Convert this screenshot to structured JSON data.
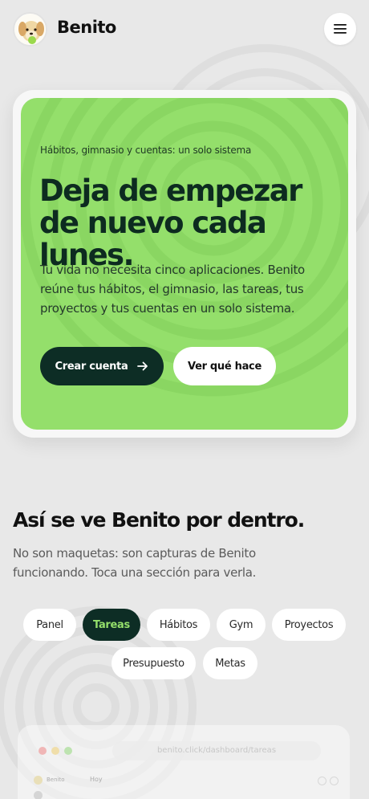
{
  "header": {
    "brand": "Benito",
    "menu_icon": "hamburger-menu-icon"
  },
  "hero": {
    "eyebrow": "Hábitos, gimnasio y cuentas: un solo sistema",
    "title": "Deja de empezar de nuevo cada lunes.",
    "subtitle": "Tu vida no necesita cinco aplicaciones. Benito reúne tus hábitos, el gimnasio, las tareas, tus proyectos y tus cuentas en un solo sistema.",
    "primary_label": "Crear cuenta",
    "primary_icon": "arrow-right-icon",
    "secondary_label": "Ver qué hace",
    "accent_color": "#94df6b",
    "dark_color": "#0d2d25"
  },
  "section": {
    "title": "Así se ve Benito por dentro.",
    "subtitle": "No son maquetas: son capturas de Benito funcionando. Toca una sección para verla."
  },
  "tabs": [
    {
      "label": "Panel",
      "active": false
    },
    {
      "label": "Tareas",
      "active": true
    },
    {
      "label": "Hábitos",
      "active": false
    },
    {
      "label": "Gym",
      "active": false
    },
    {
      "label": "Proyectos",
      "active": false
    },
    {
      "label": "Presupuesto",
      "active": false
    },
    {
      "label": "Metas",
      "active": false
    }
  ],
  "preview": {
    "url": "benito.click/dashboard/tareas",
    "brand": "Benito",
    "heading": "Hoy"
  }
}
